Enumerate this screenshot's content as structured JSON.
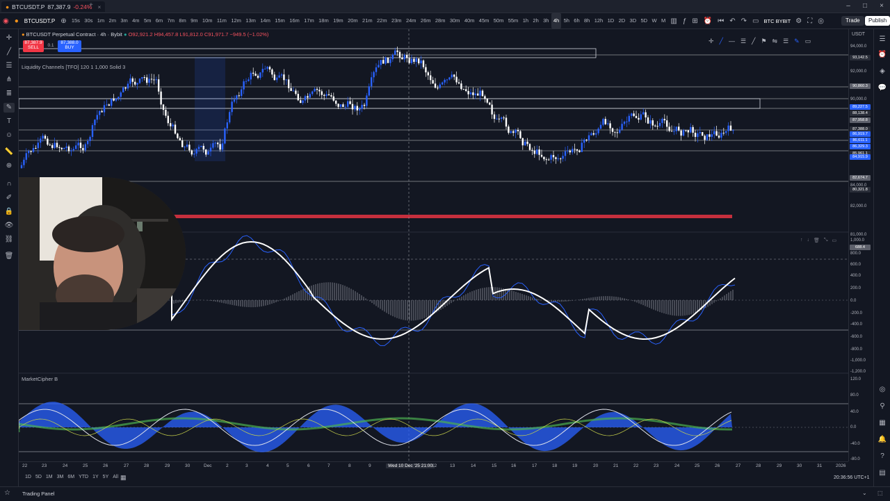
{
  "window": {
    "tabs": [
      {
        "symbol": "BTCUSDT.P",
        "price": "87,387.9",
        "change": "-0.24%"
      }
    ],
    "controls": [
      "–",
      "□",
      "×"
    ]
  },
  "toolbar": {
    "symbol": "BTCUSDT.P",
    "timeframes": [
      "15s",
      "30s",
      "1m",
      "2m",
      "3m",
      "4m",
      "5m",
      "6m",
      "7m",
      "8m",
      "9m",
      "10m",
      "11m",
      "12m",
      "13m",
      "14m",
      "15m",
      "16m",
      "17m",
      "18m",
      "19m",
      "20m",
      "21m",
      "22m",
      "23m",
      "24m",
      "26m",
      "28m",
      "30m",
      "40m",
      "45m",
      "50m",
      "55m",
      "1h",
      "2h",
      "3h",
      "4h",
      "5h",
      "6h",
      "8h",
      "12h",
      "1D",
      "2D",
      "3D",
      "5D",
      "W",
      "M"
    ],
    "active_timeframe": "4h",
    "layout_name": "BTC BYBIT",
    "trade_label": "Trade",
    "publish_label": "Publish"
  },
  "chart": {
    "title": "BTCUSDT Perpetual Contract · 4h · Bybit",
    "ohlc": "O92,921.2 H94,457.8 L91,812.0 C91,971.7 −949.5 (−1.02%)",
    "sell_price": "87,387.9",
    "sell_label": "SELL",
    "spread": "0.1",
    "buy_price": "87,388.0",
    "buy_label": "BUY",
    "indicator_1": "Liquidity Channels [TFO] 120 1 1,000 Solid 3",
    "indicator_2": "MarketCipher B"
  },
  "price_axis": {
    "currency": "USDT",
    "labels": [
      "94,000.0",
      "92,000.0",
      "90,000.0",
      "88,000.0",
      "86,000.0",
      "84,000.0",
      "82,000.0",
      "81,000.0",
      "1,000.0",
      "800.0",
      "600.0",
      "400.0",
      "200.0",
      "0.0",
      "-200.0",
      "-400.0",
      "-600.0",
      "-800.0",
      "-1,000.0",
      "-1,200.0",
      "120.0",
      "80.0",
      "40.0",
      "0.0",
      "-40.0",
      "-80.0"
    ],
    "tags": [
      {
        "text": "93,142.5",
        "bg": "#2a2e39"
      },
      {
        "text": "90,860.3",
        "bg": "#5d606b"
      },
      {
        "text": "89,227.5",
        "bg": "#2962ff"
      },
      {
        "text": "88,138.4",
        "bg": "#2a2e39"
      },
      {
        "text": "87,958.8",
        "bg": "#5d606b"
      },
      {
        "text": "87,388.0",
        "bg": "#2a2e39"
      },
      {
        "text": "86,919.7",
        "bg": "#2962ff"
      },
      {
        "text": "86,611.1",
        "bg": "#2962ff"
      },
      {
        "text": "86,329.3",
        "bg": "#2962ff"
      },
      {
        "text": "85,961.1",
        "bg": "#2a2e39"
      },
      {
        "text": "84,915.9",
        "bg": "#2962ff"
      },
      {
        "text": "82,674.7",
        "bg": "#5d606b"
      },
      {
        "text": "80,321.8",
        "bg": "#2a2e39"
      },
      {
        "text": "688.4",
        "bg": "#5d606b"
      }
    ]
  },
  "time_axis": {
    "labels": [
      "22",
      "23",
      "24",
      "25",
      "26",
      "27",
      "28",
      "29",
      "30",
      "Dec",
      "2",
      "3",
      "4",
      "5",
      "6",
      "7",
      "8",
      "9",
      "Wed 10 Dec '25  21:00",
      "12",
      "13",
      "14",
      "15",
      "16",
      "17",
      "18",
      "19",
      "20",
      "21",
      "22",
      "23",
      "24",
      "25",
      "26",
      "27",
      "28",
      "29",
      "30",
      "31",
      "2026"
    ]
  },
  "range_bar": {
    "ranges": [
      "1D",
      "5D",
      "1M",
      "3M",
      "6M",
      "YTD",
      "1Y",
      "5Y",
      "All"
    ],
    "clock": "20:36:56 UTC+1"
  },
  "bottom": {
    "trading_panel": "Trading Panel"
  },
  "colors": {
    "background": "#131722",
    "bull": "#2962ff",
    "bear": "#ffffff",
    "liquidity_line": "#f23645"
  }
}
